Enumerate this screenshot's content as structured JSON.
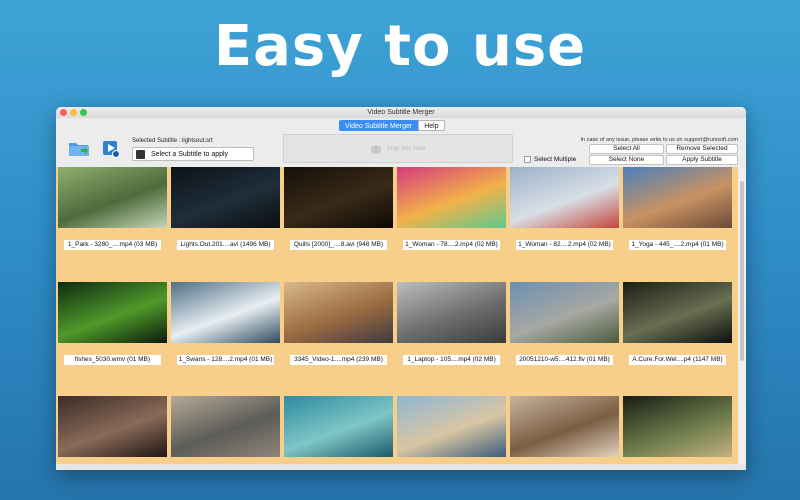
{
  "hero": {
    "title": "Easy to use"
  },
  "window": {
    "title": "Video Subtitle Merger",
    "tabs": [
      {
        "label": "Video Subtitle Merger",
        "active": true
      },
      {
        "label": "Help",
        "active": false
      }
    ]
  },
  "toolbar": {
    "add_icon": "folder-add-icon",
    "play_icon": "play-icon",
    "selected_subtitle_label": "Selected Subtitle : lightsout.srt",
    "select_subtitle_button": "Select a Subtitle to apply",
    "drop_zone_text": "Drop files here",
    "support_text": "In case of any issue, please write to us on support@runisoft.com",
    "select_all": "Select All",
    "remove_selected": "Remove Selected",
    "select_multiple": "Select Multiple",
    "select_none": "Select None",
    "apply_subtitle": "Apply Subtitle"
  },
  "videos": [
    {
      "caption": "1_Park - 3280_....mp4 (03 MB)",
      "colors": [
        "#8fb070",
        "#4e6b3c",
        "#c5d6b8"
      ]
    },
    {
      "caption": "Lights.Out.201....avi (1496 MB)",
      "colors": [
        "#0c1218",
        "#1f2e3a",
        "#0a0d10"
      ]
    },
    {
      "caption": "Quills [2000]_....8.avi (948 MB)",
      "colors": [
        "#15100a",
        "#3a2a18",
        "#0b0805"
      ]
    },
    {
      "caption": "1_Woman - 78....2.mp4 (02 MB)",
      "colors": [
        "#d63a7d",
        "#f2b24a",
        "#5cc98f"
      ]
    },
    {
      "caption": "1_Woman - 82....2.mp4 (02 MB)",
      "colors": [
        "#9bb0c8",
        "#d8dfe6",
        "#c4453b"
      ]
    },
    {
      "caption": "1_Yoga - 445_....2.mp4 (01 MB)",
      "colors": [
        "#4a7fbf",
        "#c99262",
        "#6b4a3a"
      ]
    },
    {
      "caption": "fishes_5030.wmv (01 MB)",
      "colors": [
        "#0f2a12",
        "#4f9a2a",
        "#0b1a0a"
      ]
    },
    {
      "caption": "1_Swans - 128....2.mp4 (01 MB)",
      "colors": [
        "#4f6f86",
        "#e8eef2",
        "#2c4a5e"
      ]
    },
    {
      "caption": "3345_Video-1....mp4 (239 MB)",
      "colors": [
        "#d8b98a",
        "#9c6b43",
        "#3d3a40"
      ]
    },
    {
      "caption": "1_Laptop - 105....mp4 (02 MB)",
      "colors": [
        "#bdbdbd",
        "#6e6e6e",
        "#3a3a3a"
      ]
    },
    {
      "caption": "20051210-w5....412.flv (01 MB)",
      "colors": [
        "#6d8fb3",
        "#a7a8a2",
        "#4a5a3c"
      ]
    },
    {
      "caption": "A.Cure.For.Wel....p4 (1147 MB)",
      "colors": [
        "#1a1f16",
        "#6a6e52",
        "#0c0f0a"
      ]
    },
    {
      "caption": "",
      "colors": [
        "#3a2c26",
        "#8a6a58",
        "#1e1613"
      ]
    },
    {
      "caption": "",
      "colors": [
        "#b6aa98",
        "#5d5c58",
        "#8e8478"
      ]
    },
    {
      "caption": "",
      "colors": [
        "#2e8aa0",
        "#7fc6c6",
        "#1c5a6a"
      ]
    },
    {
      "caption": "",
      "colors": [
        "#8fb6d2",
        "#d8c6a4",
        "#3c5c7a"
      ]
    },
    {
      "caption": "",
      "colors": [
        "#c8b49a",
        "#7a5e44",
        "#e3d3bc"
      ]
    },
    {
      "caption": "",
      "colors": [
        "#1a1c14",
        "#6a7a4a",
        "#c4b080"
      ]
    }
  ]
}
